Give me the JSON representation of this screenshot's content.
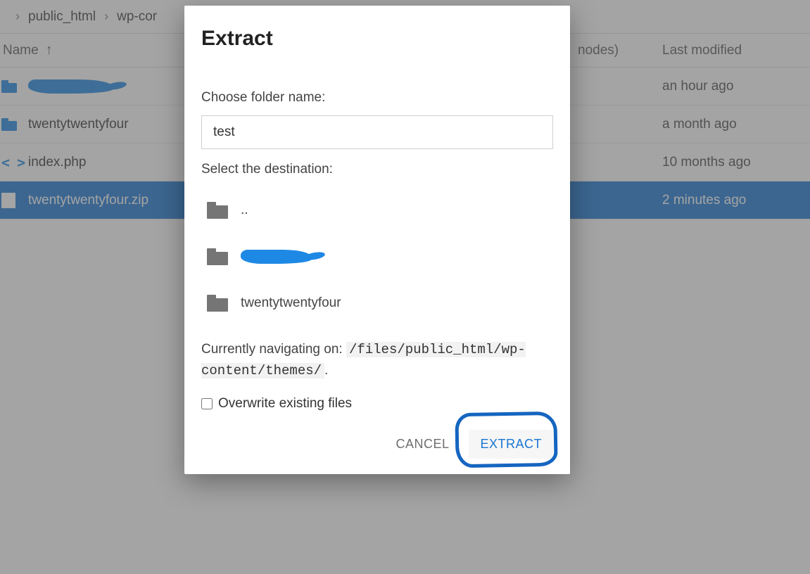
{
  "breadcrumb": {
    "parts": [
      "public_html",
      "wp-cor"
    ]
  },
  "columns": {
    "name": "Name",
    "modified": "Last modified",
    "hidden_col": "nodes)"
  },
  "rows": [
    {
      "type": "folder",
      "name_is_redacted": true,
      "modified": "an hour ago"
    },
    {
      "type": "folder",
      "name": "twentytwentyfour",
      "modified": "a month ago"
    },
    {
      "type": "php",
      "name": "index.php",
      "modified": "10 months ago"
    },
    {
      "type": "zip",
      "name": "twentytwentyfour.zip",
      "modified": "2 minutes ago",
      "selected": true
    }
  ],
  "modal": {
    "title": "Extract",
    "choose_label": "Choose folder name:",
    "folder_name": "test",
    "destination_label": "Select the destination:",
    "dest_items": [
      {
        "label": "..",
        "redacted": false
      },
      {
        "label": "",
        "redacted": true
      },
      {
        "label": "twentytwentyfour",
        "redacted": false
      }
    ],
    "curnav_prefix": "Currently navigating on: ",
    "curnav_path": "/files/public_html/wp-content/themes/",
    "curnav_suffix": ".",
    "overwrite_label": "Overwrite existing files",
    "overwrite_checked": false,
    "cancel_label": "CANCEL",
    "extract_label": "EXTRACT"
  }
}
